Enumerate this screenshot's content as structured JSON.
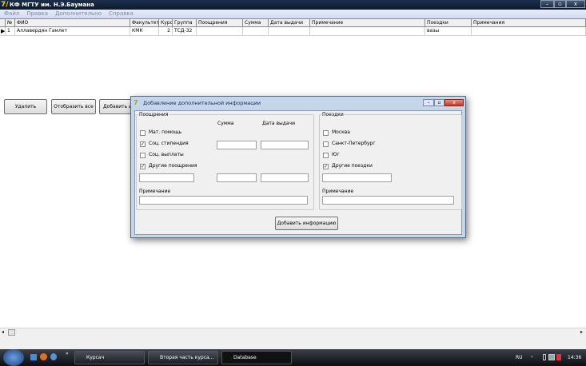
{
  "window": {
    "title": "КФ МГТУ им. Н.Э.Баумана",
    "icon": "7/",
    "min": "–",
    "max": "▫",
    "close": "x"
  },
  "menu": [
    "Файл",
    "Правка",
    "Дополнительно",
    "Справка"
  ],
  "grid": {
    "headers": [
      "№",
      "ФИО",
      "Факультет",
      "Курс",
      "Группа",
      "Поощрения",
      "Сумма",
      "Дата выдачи",
      "Примечание",
      "Поездки",
      "Примечания"
    ],
    "rows": [
      [
        "1",
        "Аллавердян Гамлет",
        "КМК",
        "2",
        "ТСД-32",
        "",
        "",
        "",
        "",
        "вазы",
        ""
      ]
    ]
  },
  "buttons": {
    "delete": "Удалить",
    "show_all": "Отобразить все",
    "add": "Добавить и"
  },
  "dialog": {
    "title": "Добавление дополнительной информации",
    "left": {
      "legend": "Поощрения",
      "sum_label": "Сумма",
      "date_label": "Дата выдачи",
      "items": [
        {
          "label": "Мат. помощь",
          "checked": false
        },
        {
          "label": "Соц. стипендия",
          "checked": true
        },
        {
          "label": "Соц. выплаты",
          "checked": false
        },
        {
          "label": "Другие поощрения",
          "checked": true
        }
      ],
      "note_label": "Примечание"
    },
    "right": {
      "legend": "Поездки",
      "items": [
        {
          "label": "Москва",
          "checked": false
        },
        {
          "label": "Санкт-Петербург",
          "checked": false
        },
        {
          "label": "Юг",
          "checked": false
        },
        {
          "label": "Другие поездки",
          "checked": true
        }
      ],
      "note_label": "Примечание"
    },
    "submit": "Добавить информацию"
  },
  "taskbar": {
    "tasks": [
      "Курсач",
      "Вторая часть курса...",
      "Database"
    ],
    "lang": "RU",
    "time": "14:36"
  }
}
